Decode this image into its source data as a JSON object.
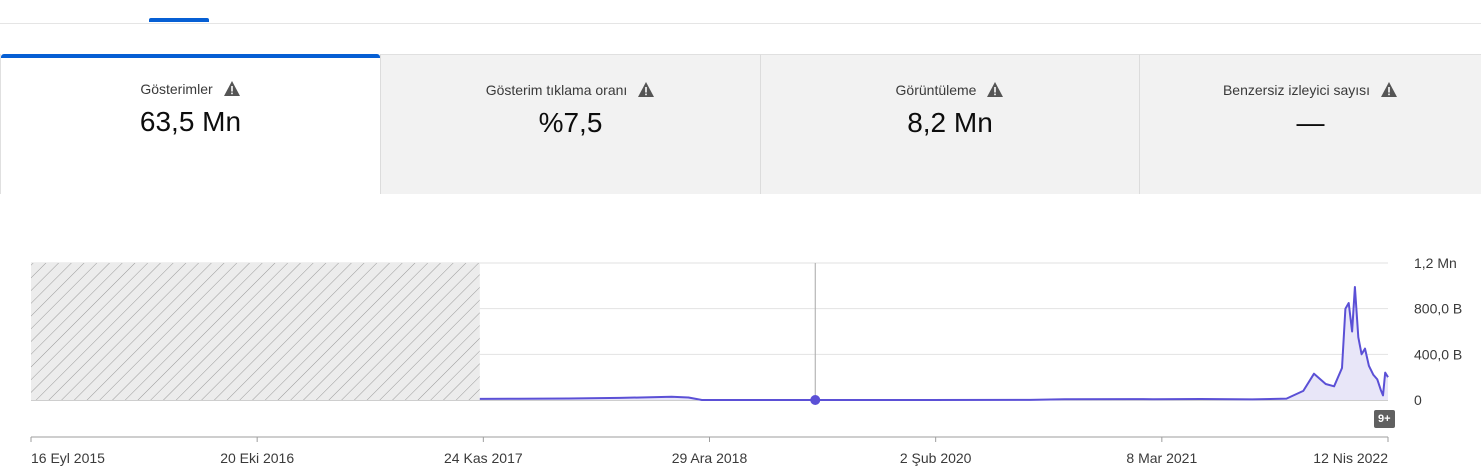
{
  "metrics": [
    {
      "label": "Gösterimler",
      "value": "63,5 Mn",
      "selected": true,
      "icon": "warning-icon"
    },
    {
      "label": "Gösterim tıklama oranı",
      "value": "%7,5",
      "selected": false,
      "icon": "warning-icon"
    },
    {
      "label": "Görüntüleme",
      "value": "8,2 Mn",
      "selected": false,
      "icon": "warning-icon"
    },
    {
      "label": "Benzersiz izleyici sayısı",
      "value": "—",
      "selected": false,
      "icon": "warning-icon"
    }
  ],
  "colors": {
    "accent": "#065fd4",
    "series": "#5b50d6",
    "series_fill": "#e8e6f8"
  },
  "badge": "9+",
  "chart_data": {
    "type": "line",
    "x_tick_labels": [
      "16 Eyl 2015",
      "20 Eki 2016",
      "24 Kas 2017",
      "29 Ara 2018",
      "2 Şub 2020",
      "8 Mar 2021",
      "12 Nis 2022"
    ],
    "x_range": [
      "2015-09-16",
      "2022-05-01"
    ],
    "y_tick_labels": [
      "0",
      "400,0 B",
      "800,0 B",
      "1,2 Mn"
    ],
    "y_ticks": [
      0,
      400000,
      800000,
      1200000
    ],
    "ylim": [
      0,
      1200000
    ],
    "no_data_until": "2017-11-24",
    "hover_date": "2019-07-15",
    "grid": true,
    "series": [
      {
        "values": [
          [
            "2017-11-24",
            10000
          ],
          [
            "2018-02-01",
            11000
          ],
          [
            "2018-05-01",
            13000
          ],
          [
            "2018-08-01",
            18000
          ],
          [
            "2018-11-01",
            28000
          ],
          [
            "2018-12-01",
            22000
          ],
          [
            "2018-12-25",
            0
          ],
          [
            "2019-07-15",
            0
          ],
          [
            "2020-02-02",
            0
          ],
          [
            "2020-08-01",
            1000
          ],
          [
            "2020-10-01",
            6000
          ],
          [
            "2021-02-01",
            8000
          ],
          [
            "2021-03-08",
            7000
          ],
          [
            "2021-06-01",
            9000
          ],
          [
            "2021-09-01",
            5000
          ],
          [
            "2021-11-01",
            12000
          ],
          [
            "2021-12-01",
            80000
          ],
          [
            "2021-12-20",
            230000
          ],
          [
            "2022-01-10",
            140000
          ],
          [
            "2022-01-25",
            120000
          ],
          [
            "2022-02-08",
            280000
          ],
          [
            "2022-02-14",
            800000
          ],
          [
            "2022-02-20",
            850000
          ],
          [
            "2022-02-26",
            600000
          ],
          [
            "2022-03-03",
            990000
          ],
          [
            "2022-03-09",
            550000
          ],
          [
            "2022-03-15",
            400000
          ],
          [
            "2022-03-21",
            450000
          ],
          [
            "2022-03-28",
            300000
          ],
          [
            "2022-04-05",
            220000
          ],
          [
            "2022-04-12",
            180000
          ],
          [
            "2022-04-18",
            90000
          ],
          [
            "2022-04-22",
            40000
          ],
          [
            "2022-04-26",
            240000
          ],
          [
            "2022-05-01",
            200000
          ]
        ]
      }
    ]
  }
}
